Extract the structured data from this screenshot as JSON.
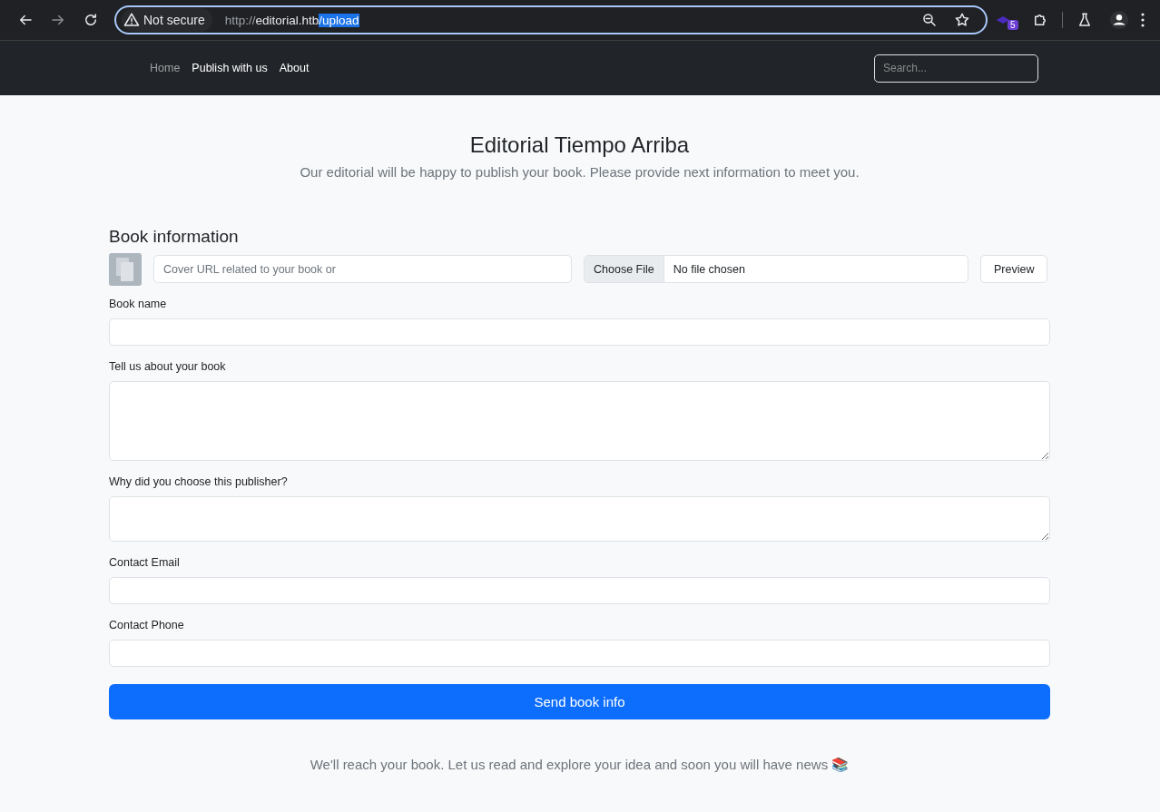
{
  "browser": {
    "security_label": "Not secure",
    "url_scheme": "http://",
    "url_host": "editorial.htb",
    "url_path": "/upload",
    "extension_badge": "5"
  },
  "navbar": {
    "links": [
      {
        "label": "Home",
        "disabled": true
      },
      {
        "label": "Publish with us",
        "disabled": false
      },
      {
        "label": "About",
        "disabled": false
      }
    ],
    "search": {
      "placeholder": "Search..."
    }
  },
  "header": {
    "title": "Editorial Tiempo Arriba",
    "subtitle": "Our editorial will be happy to publish your book. Please provide next information to meet you."
  },
  "form": {
    "section_title": "Book information",
    "cover": {
      "url_placeholder": "Cover URL related to your book or",
      "file_button": "Choose File",
      "file_status": "No file chosen",
      "preview_button": "Preview"
    },
    "fields": [
      {
        "kind": "input",
        "label": "Book name"
      },
      {
        "kind": "memo",
        "label": "Tell us about your book"
      },
      {
        "kind": "textarea",
        "label": "Why did you choose this publisher?"
      },
      {
        "kind": "input",
        "label": "Contact Email"
      },
      {
        "kind": "input",
        "label": "Contact Phone"
      }
    ],
    "submit": "Send book info"
  },
  "footer": {
    "text": "We'll reach your book. Let us read and explore your idea and soon you will have news 📚"
  }
}
